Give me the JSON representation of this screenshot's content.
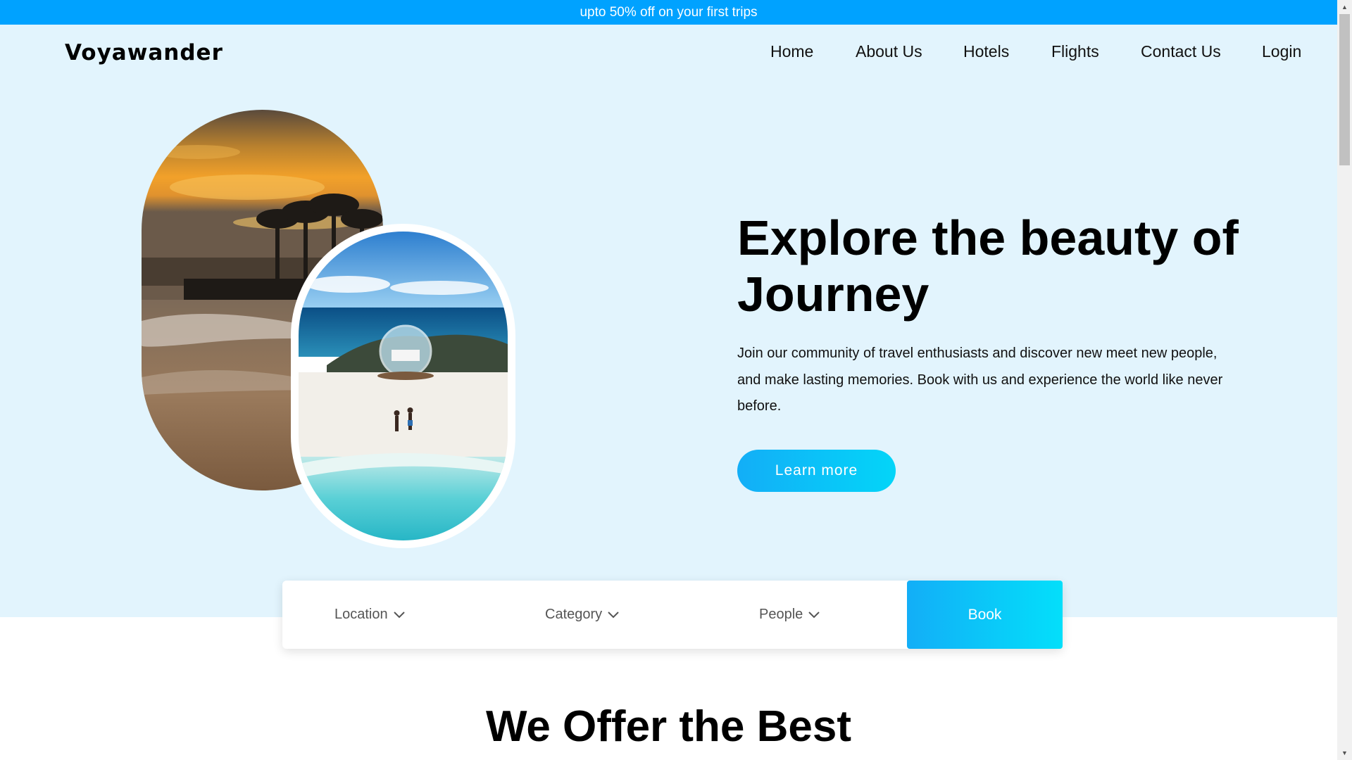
{
  "promo": {
    "text": "upto 50% off on your first trips"
  },
  "header": {
    "logo": "Voyawander",
    "nav": [
      {
        "label": "Home"
      },
      {
        "label": "About Us"
      },
      {
        "label": "Hotels"
      },
      {
        "label": "Flights"
      },
      {
        "label": "Contact Us"
      },
      {
        "label": "Login"
      }
    ]
  },
  "hero": {
    "title": "Explore the beauty of Journey",
    "description": "Join our community of travel enthusiasts and discover new meet new people, and make lasting memories. Book with us and experience the world like never before.",
    "cta_label": "Learn more"
  },
  "booking": {
    "location_label": "Location",
    "category_label": "Category",
    "people_label": "People",
    "book_label": "Book"
  },
  "offer_section": {
    "title": "We Offer the Best"
  },
  "icons": {
    "dropdown": "chevron-down-icon",
    "scroll_up": "scroll-up-arrow-icon",
    "scroll_down": "scroll-down-arrow-icon"
  },
  "colors": {
    "promo_bg": "#00a2ff",
    "hero_bg": "#e2f4fd",
    "accent_gradient_start": "#13aef7",
    "accent_gradient_end": "#03d5f8"
  }
}
